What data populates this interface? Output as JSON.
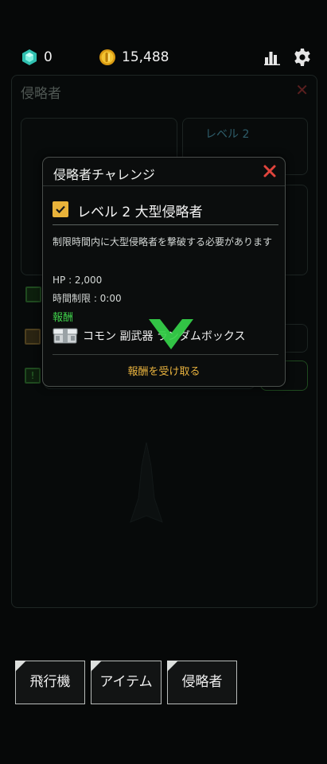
{
  "topbar": {
    "gems": "0",
    "coins": "15,488",
    "icons": [
      "gem-icon",
      "coin-icon",
      "stats-icon",
      "gear-icon"
    ]
  },
  "background": {
    "panel_title": "侵略者",
    "level_label": "レベル 2"
  },
  "modal": {
    "title": "侵略者チャレンジ",
    "level_title": "レベル 2 大型侵略者",
    "description": "制限時間内に大型侵略者を撃破する必要があります",
    "hp": "HP : 2,000",
    "time_limit": "時間制限 : 0:00",
    "reward_label": "報酬",
    "reward_item": "コモン 副武器 ランダムボックス",
    "claim_button": "報酬を受け取る"
  },
  "tabs": [
    {
      "label": "飛行機"
    },
    {
      "label": "アイテム"
    },
    {
      "label": "侵略者"
    }
  ],
  "colors": {
    "accent_gold": "#e9b33a",
    "reward_green": "#3fcf4a",
    "close_red": "#e0443c",
    "chevron_green": "#36d34a"
  }
}
